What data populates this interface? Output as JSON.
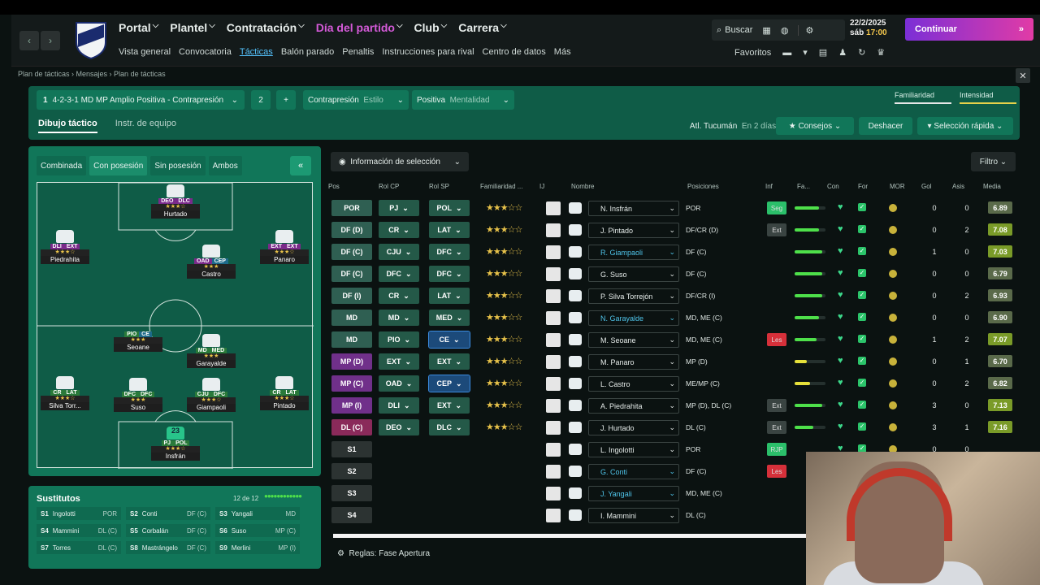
{
  "nav": {
    "main": [
      "Portal",
      "Plantel",
      "Contratación",
      "Día del partido",
      "Club",
      "Carrera"
    ],
    "active_main": "Día del partido",
    "sub": [
      "Vista general",
      "Convocatoria",
      "Tácticas",
      "Balón parado",
      "Penaltis",
      "Instrucciones para rival",
      "Centro de datos",
      "Más"
    ],
    "active_sub": "Tácticas"
  },
  "header": {
    "search": "Buscar",
    "date": "22/2/2025",
    "time_prefix": "sáb",
    "time": "17:00",
    "continue": "Continuar",
    "favoritos": "Favoritos"
  },
  "breadcrumb": "Plan de tácticas › Mensajes › Plan de tácticas",
  "tactic": {
    "slot": "1",
    "name": "4-2-3-1 MD MP Amplio Positiva - Contrapresión",
    "slot2": "2",
    "add": "+",
    "style_value": "Contrapresión",
    "style_label": "Estilo",
    "mental_value": "Positiva",
    "mental_label": "Mentalidad",
    "familiarity": "Familiaridad",
    "intensity": "Intensidad"
  },
  "tabs": {
    "drawing": "Dibujo táctico",
    "team": "Instr. de equipo"
  },
  "controls": {
    "next": "Atl. Tucumán",
    "next_when": "En 2 días",
    "consejos": "Consejos",
    "undo": "Deshacer",
    "quick": "Selección rápida"
  },
  "pitch_tabs": [
    "Combinada",
    "Con posesión",
    "Sin posesión",
    "Ambos"
  ],
  "pitch_players": [
    {
      "name": "Hurtado",
      "roles": [
        "DEO",
        "DLC"
      ],
      "stars": "★★★☆"
    },
    {
      "name": "Piedrahita",
      "roles": [
        "DLI",
        "EXT"
      ],
      "stars": "★★★☆"
    },
    {
      "name": "Castro",
      "roles": [
        "OAD",
        "CEP"
      ],
      "stars": "★★★"
    },
    {
      "name": "Panaro",
      "roles": [
        "EXT",
        "EXT"
      ],
      "stars": "★★★☆"
    },
    {
      "name": "Seoane",
      "roles": [
        "PIO",
        "CE"
      ],
      "stars": "★★★"
    },
    {
      "name": "Garayalde",
      "roles": [
        "MD",
        "MED"
      ],
      "stars": "★★★"
    },
    {
      "name": "Silva Torr...",
      "roles": [
        "CR",
        "LAT"
      ],
      "stars": "★★★☆"
    },
    {
      "name": "Suso",
      "roles": [
        "DFC",
        "DFC"
      ],
      "stars": "★★★"
    },
    {
      "name": "Giampaoli",
      "roles": [
        "CJU",
        "DFC"
      ],
      "stars": "★★★☆"
    },
    {
      "name": "Pintado",
      "roles": [
        "CR",
        "LAT"
      ],
      "stars": "★★★☆"
    },
    {
      "name": "Insfrán",
      "roles": [
        "PJ",
        "POL"
      ],
      "stars": "★★★☆",
      "number": "23"
    }
  ],
  "subs": {
    "title": "Sustitutos",
    "count": "12 de 12",
    "items": [
      {
        "n": "S1",
        "name": "Ingolotti",
        "pos": "POR"
      },
      {
        "n": "S2",
        "name": "Conti",
        "pos": "DF (C)"
      },
      {
        "n": "S3",
        "name": "Yangali",
        "pos": "MD"
      },
      {
        "n": "S4",
        "name": "Mammini",
        "pos": "DL (C)"
      },
      {
        "n": "S5",
        "name": "Corbalán",
        "pos": "DF (C)"
      },
      {
        "n": "S6",
        "name": "Suso",
        "pos": "MP (C)"
      },
      {
        "n": "S7",
        "name": "Torres",
        "pos": "DL (C)"
      },
      {
        "n": "S8",
        "name": "Mastrángelo",
        "pos": "DF (C)"
      },
      {
        "n": "S9",
        "name": "Merlini",
        "pos": "MP (I)"
      }
    ]
  },
  "info_select": "Información de selección",
  "filter": "Filtro",
  "columns": [
    "Pos",
    "Rol CP",
    "Rol SP",
    "Familiaridad ...",
    "IJ",
    "Nombre",
    "Posiciones",
    "Inf",
    "Fa...",
    "Con",
    "For",
    "MOR",
    "Gol",
    "Asis",
    "Media"
  ],
  "rows": [
    {
      "pos": "POR",
      "cp": "PJ",
      "sp": "POL",
      "stars": "★★★☆☆",
      "name": "N. Insfrán",
      "posiciones": "POR",
      "inf": "Seg",
      "fa": 0.8,
      "gol": "0",
      "asis": "0",
      "media": "6.89"
    },
    {
      "pos": "DF (D)",
      "cp": "CR",
      "sp": "LAT",
      "stars": "★★★☆☆",
      "name": "J. Pintado",
      "posiciones": "DF/CR (D)",
      "inf": "Ext",
      "fa": 0.8,
      "gol": "0",
      "asis": "2",
      "media": "7.08"
    },
    {
      "pos": "DF (C)",
      "cp": "CJU",
      "sp": "DFC",
      "stars": "★★★☆☆",
      "name": "R. Giampaoli",
      "posiciones": "DF (C)",
      "inf": "",
      "fa": 0.9,
      "gol": "1",
      "asis": "0",
      "media": "7.03"
    },
    {
      "pos": "DF (C)",
      "cp": "DFC",
      "sp": "DFC",
      "stars": "★★★☆☆",
      "name": "G. Suso",
      "posiciones": "DF (C)",
      "inf": "",
      "fa": 0.9,
      "gol": "0",
      "asis": "0",
      "media": "6.79"
    },
    {
      "pos": "DF (I)",
      "cp": "CR",
      "sp": "LAT",
      "stars": "★★★☆☆",
      "name": "P. Silva Torrejón",
      "posiciones": "DF/CR (I)",
      "inf": "",
      "fa": 0.9,
      "gol": "0",
      "asis": "2",
      "media": "6.93"
    },
    {
      "pos": "MD",
      "cp": "MD",
      "sp": "MED",
      "stars": "★★★☆☆",
      "name": "N. Garayalde",
      "posiciones": "MD, ME (C)",
      "inf": "",
      "fa": 0.8,
      "gol": "0",
      "asis": "0",
      "media": "6.90"
    },
    {
      "pos": "MD",
      "cp": "PIO",
      "sp": "CE",
      "stars": "★★★☆☆",
      "name": "M. Seoane",
      "posiciones": "MD, ME (C)",
      "inf": "Les",
      "fa": 0.7,
      "gol": "1",
      "asis": "2",
      "media": "7.07"
    },
    {
      "pos": "MP (D)",
      "cp": "EXT",
      "sp": "EXT",
      "stars": "★★★☆☆",
      "name": "M. Panaro",
      "posiciones": "MP (D)",
      "inf": "",
      "fa": 0.4,
      "gol": "0",
      "asis": "1",
      "media": "6.70"
    },
    {
      "pos": "MP (C)",
      "cp": "OAD",
      "sp": "CEP",
      "stars": "★★★☆☆",
      "name": "L. Castro",
      "posiciones": "ME/MP (C)",
      "inf": "",
      "fa": 0.5,
      "gol": "0",
      "asis": "2",
      "media": "6.82"
    },
    {
      "pos": "MP (I)",
      "cp": "DLI",
      "sp": "EXT",
      "stars": "★★★☆☆",
      "name": "A. Piedrahita",
      "posiciones": "MP (D), DL (C)",
      "inf": "Ext",
      "fa": 0.9,
      "gol": "3",
      "asis": "0",
      "media": "7.13"
    },
    {
      "pos": "DL (C)",
      "cp": "DEO",
      "sp": "DLC",
      "stars": "★★★☆☆",
      "name": "J. Hurtado",
      "posiciones": "DL (C)",
      "inf": "Ext",
      "fa": 0.6,
      "gol": "3",
      "asis": "1",
      "media": "7.16"
    },
    {
      "pos": "S1",
      "cp": "",
      "sp": "",
      "stars": "",
      "name": "L. Ingolotti",
      "posiciones": "POR",
      "inf": "RJP",
      "fa": 0,
      "gol": "0",
      "asis": "0",
      "media": ""
    },
    {
      "pos": "S2",
      "cp": "",
      "sp": "",
      "stars": "",
      "name": "G. Conti",
      "posiciones": "DF (C)",
      "inf": "Les",
      "fa": 0,
      "gol": "",
      "asis": "",
      "media": ""
    },
    {
      "pos": "S3",
      "cp": "",
      "sp": "",
      "stars": "",
      "name": "J. Yangali",
      "posiciones": "MD, ME (C)",
      "inf": "",
      "fa": 0,
      "gol": "",
      "asis": "",
      "media": ""
    },
    {
      "pos": "S4",
      "cp": "",
      "sp": "",
      "stars": "",
      "name": "I. Mammini",
      "posiciones": "DL (C)",
      "inf": "",
      "fa": 0,
      "gol": "",
      "asis": "",
      "media": ""
    }
  ],
  "footer": {
    "reglas": "Reglas: Fase Apertura"
  }
}
